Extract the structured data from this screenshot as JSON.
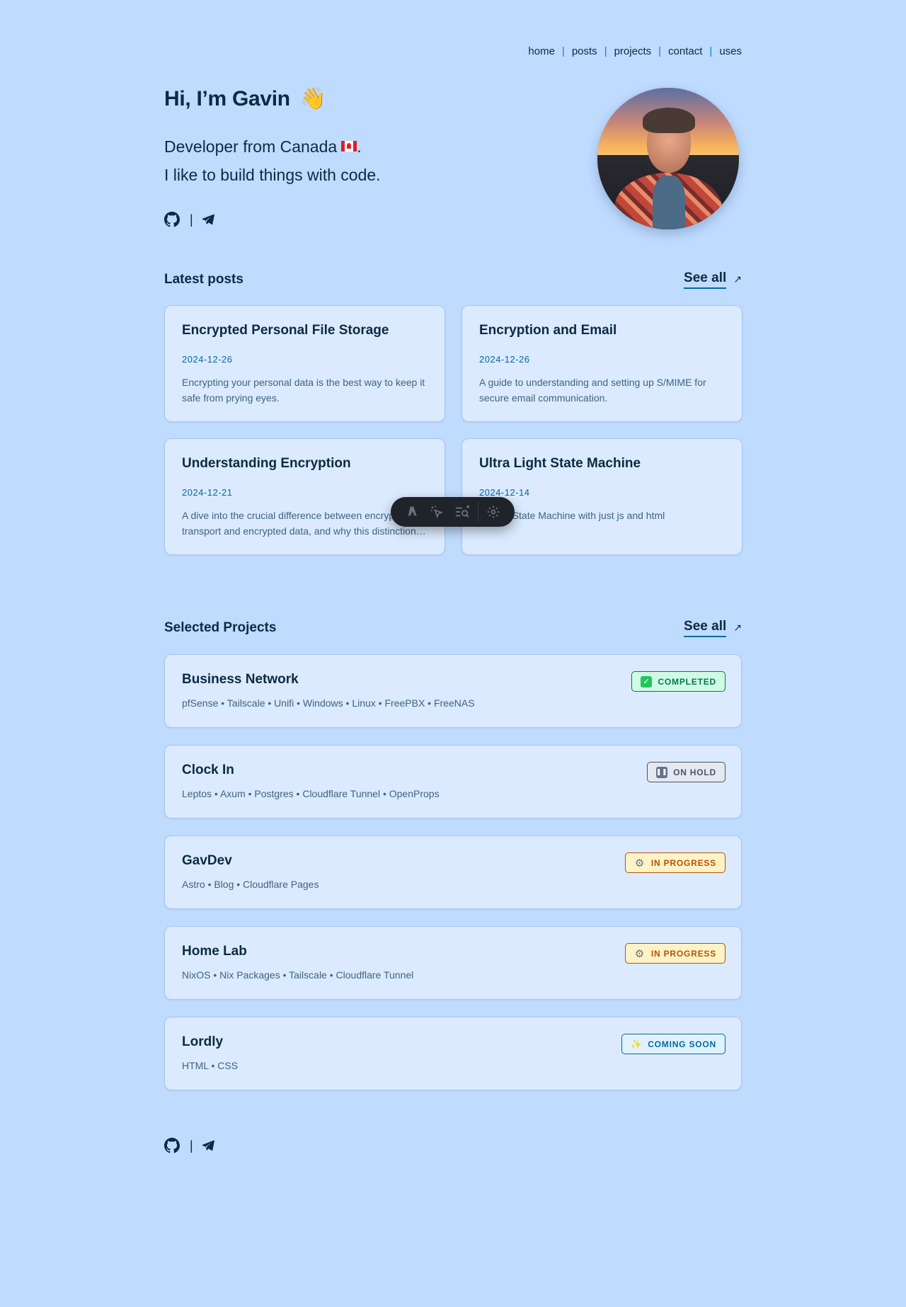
{
  "nav": {
    "items": [
      "home",
      "posts",
      "projects",
      "contact",
      "uses"
    ]
  },
  "hero": {
    "title": "Hi, I’m Gavin",
    "wave": "👋",
    "line1": "Developer from Canada",
    "line1_suffix": ".",
    "line2": "I like to build things with code.",
    "separator": "|",
    "icons": [
      "github-icon",
      "telegram-icon"
    ]
  },
  "posts_section": {
    "title": "Latest posts",
    "see_all": "See all",
    "arrow": "↗",
    "posts": [
      {
        "title": "Encrypted Personal File Storage",
        "date": "2024-12-26",
        "desc": "Encrypting your personal data is the best way to keep it safe from prying eyes."
      },
      {
        "title": "Encryption and Email",
        "date": "2024-12-26",
        "desc": "A guide to understanding and setting up S/MIME for secure email communication."
      },
      {
        "title": "Understanding Encryption",
        "date": "2024-12-21",
        "desc": "A dive into the crucial difference between encrypted transport and encrypted data, and why this distinction matters."
      },
      {
        "title": "Ultra Light State Machine",
        "date": "2024-12-14",
        "desc": "Build a State Machine with just js and html"
      }
    ]
  },
  "projects_section": {
    "title": "Selected Projects",
    "see_all": "See all",
    "arrow": "↗",
    "projects": [
      {
        "title": "Business Network",
        "stack": "pfSense • Tailscale • Unifi • Windows • Linux • FreePBX • FreeNAS",
        "status": "COMPLETED",
        "status_icon": "✓"
      },
      {
        "title": "Clock In",
        "stack": "Leptos • Axum • Postgres • Cloudflare Tunnel • OpenProps",
        "status": "ON HOLD",
        "status_icon": "❚❚"
      },
      {
        "title": "GavDev",
        "stack": "Astro • Blog • Cloudflare Pages",
        "status": "IN PROGRESS",
        "status_icon": "⚙"
      },
      {
        "title": "Home Lab",
        "stack": "NixOS • Nix Packages • Tailscale • Cloudflare Tunnel",
        "status": "IN PROGRESS",
        "status_icon": "⚙"
      },
      {
        "title": "Lordly",
        "stack": "HTML • CSS",
        "status": "COMING SOON",
        "status_icon": "✨"
      }
    ]
  },
  "toolbar": {
    "icons": [
      "astro-logo-icon",
      "cursor-click-icon",
      "search-list-icon",
      "settings-gear-icon"
    ]
  },
  "colors": {
    "background": "#bfdbfe",
    "card": "#dbeafe",
    "accent": "#0369a1",
    "text": "#0c2a43"
  }
}
